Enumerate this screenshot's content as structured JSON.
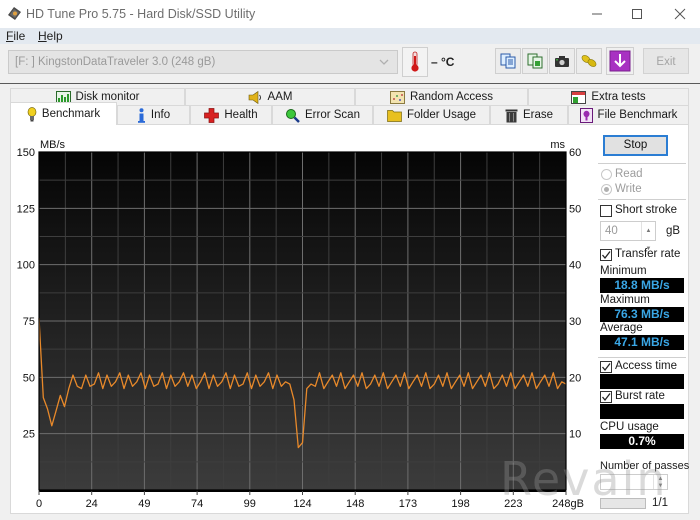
{
  "window": {
    "title": "HD Tune Pro 5.75 - Hard Disk/SSD Utility",
    "icon": "hd-tune-disk-icon",
    "controls": [
      "minimize-icon",
      "maximize-icon",
      "close-icon"
    ]
  },
  "menu": {
    "items": [
      {
        "label_first": "F",
        "label_rest": "ile"
      },
      {
        "label_first": "H",
        "label_rest": "elp"
      }
    ]
  },
  "toolbar": {
    "drive": "[F: ] KingstonDataTraveler 3.0 (248 gB)",
    "temperature": "– °C",
    "buttons": [
      {
        "icon": "copy-text-icon"
      },
      {
        "icon": "copy-image-icon"
      },
      {
        "icon": "camera-icon"
      },
      {
        "icon": "options-chain-icon"
      },
      {
        "icon": "save-download-icon"
      }
    ],
    "exit_label": "Exit"
  },
  "tabs": {
    "top": [
      {
        "label": "Disk monitor",
        "icon": "disk-monitor-icon"
      },
      {
        "label": "AAM",
        "icon": "speaker-icon"
      },
      {
        "label": "Random Access",
        "icon": "random-access-icon"
      },
      {
        "label": "Extra tests",
        "icon": "extra-tests-icon"
      }
    ],
    "bottom": [
      {
        "label": "Benchmark",
        "icon": "lightbulb-icon",
        "selected": true
      },
      {
        "label": "Info",
        "icon": "info-icon"
      },
      {
        "label": "Health",
        "icon": "health-cross-icon"
      },
      {
        "label": "Error Scan",
        "icon": "magnifier-icon"
      },
      {
        "label": "Folder Usage",
        "icon": "folder-icon"
      },
      {
        "label": "Erase",
        "icon": "trash-icon"
      },
      {
        "label": "File Benchmark",
        "icon": "file-benchmark-icon"
      }
    ]
  },
  "side": {
    "stop_label": "Stop",
    "read_label": "Read",
    "write_label": "Write",
    "mode_selected": "Write",
    "short_stroke_label": "Short stroke",
    "short_stroke_checked": false,
    "short_stroke_value": "40",
    "short_stroke_unit": "gB",
    "transfer_rate_label": "Transfer rate",
    "transfer_rate_checked": true,
    "minimum_label": "Minimum",
    "minimum_value": "18.8 MB/s",
    "maximum_label": "Maximum",
    "maximum_value": "76.3 MB/s",
    "average_label": "Average",
    "average_value": "47.1 MB/s",
    "access_time_label": "Access time",
    "access_time_checked": true,
    "access_time_value": "",
    "burst_rate_label": "Burst rate",
    "burst_rate_checked": true,
    "burst_rate_value": "",
    "cpu_usage_label": "CPU usage",
    "cpu_usage_value": "0.7%",
    "passes_label": "Number of passes",
    "passes_value": "",
    "passes_progress": "1/1",
    "passes_progress_fraction": 1.0
  },
  "colors": {
    "series": "#e8892a",
    "value_text": "#3aa7e6",
    "focus_border": "#2b7dd3"
  },
  "watermark": "Revain",
  "chart_data": {
    "type": "line",
    "title": "",
    "xlabel": "",
    "x_unit": "gB",
    "ylabel": "MB/s",
    "y2label": "ms",
    "xlim": [
      0,
      248
    ],
    "ylim": [
      0,
      150
    ],
    "y2lim": [
      0,
      60
    ],
    "grid": true,
    "x_ticks": [
      "0",
      "24",
      "49",
      "74",
      "99",
      "124",
      "148",
      "173",
      "198",
      "223",
      "248gB"
    ],
    "x_tick_values": [
      0,
      24.8,
      49.6,
      74.4,
      99.2,
      124,
      148.8,
      173.6,
      198.4,
      223.2,
      248
    ],
    "y_ticks": [
      "150",
      "125",
      "100",
      "75",
      "50",
      "25"
    ],
    "y_tick_values": [
      150,
      125,
      100,
      75,
      50,
      25
    ],
    "y2_ticks": [
      "60",
      "50",
      "40",
      "30",
      "20",
      "10"
    ],
    "y2_tick_values": [
      60,
      50,
      40,
      30,
      20,
      10
    ],
    "series": [
      {
        "name": "Transfer rate",
        "axis": "left",
        "x_start": 0,
        "x_step": 2,
        "values": [
          76.3,
          41,
          36,
          28.5,
          35,
          42,
          37,
          45,
          51,
          46,
          45,
          51,
          46,
          47,
          52,
          45,
          51,
          46,
          48,
          52,
          45,
          51,
          46,
          48,
          52,
          45,
          51,
          46,
          47,
          52,
          45,
          51,
          46,
          48,
          52,
          46,
          51,
          45,
          48,
          52,
          45,
          51,
          46,
          48,
          52,
          45,
          51,
          46,
          47,
          52,
          45,
          51,
          46,
          48,
          52,
          45,
          51,
          46,
          48,
          47,
          40,
          18.8,
          21,
          45,
          47,
          46,
          52,
          45,
          48,
          51,
          46,
          52,
          45,
          48,
          51,
          46,
          52,
          45,
          47,
          51,
          46,
          52,
          45,
          48,
          51,
          46,
          52,
          45,
          48,
          51,
          46,
          52,
          45,
          47,
          51,
          46,
          52,
          45,
          48,
          51,
          46,
          52,
          45,
          48,
          51,
          46,
          52,
          45,
          47,
          51,
          46,
          52,
          45,
          48,
          51,
          46,
          52,
          45,
          48,
          51,
          46,
          52,
          45,
          48,
          47
        ]
      }
    ]
  }
}
